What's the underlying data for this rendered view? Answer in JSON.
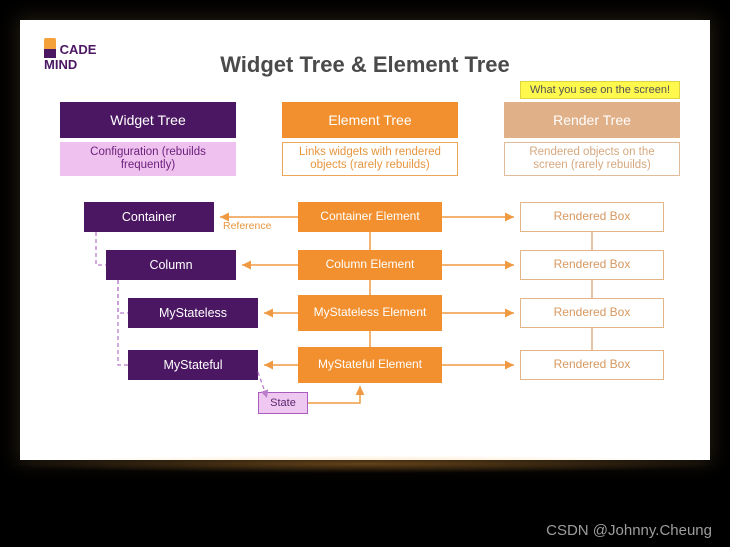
{
  "logo": {
    "line1": "CADE",
    "line2": "MIND"
  },
  "title": "Widget Tree & Element Tree",
  "headers": {
    "widget": "Widget Tree",
    "element": "Element Tree",
    "render": "Render Tree"
  },
  "callout": "What you see on the screen!",
  "subheaders": {
    "widget": "Configuration (rebuilds frequently)",
    "element": "Links widgets with rendered objects (rarely rebuilds)",
    "render": "Rendered objects on the screen (rarely rebuilds)"
  },
  "widget_nodes": [
    "Container",
    "Column",
    "MyStateless",
    "MyStateful"
  ],
  "element_nodes": [
    "Container Element",
    "Column Element",
    "MyStateless Element",
    "MyStateful Element"
  ],
  "render_nodes": [
    "Rendered Box",
    "Rendered Box",
    "Rendered Box",
    "Rendered Box"
  ],
  "state_label": "State",
  "reference_label": "Reference",
  "watermark": "CSDN @Johnny.Cheung"
}
